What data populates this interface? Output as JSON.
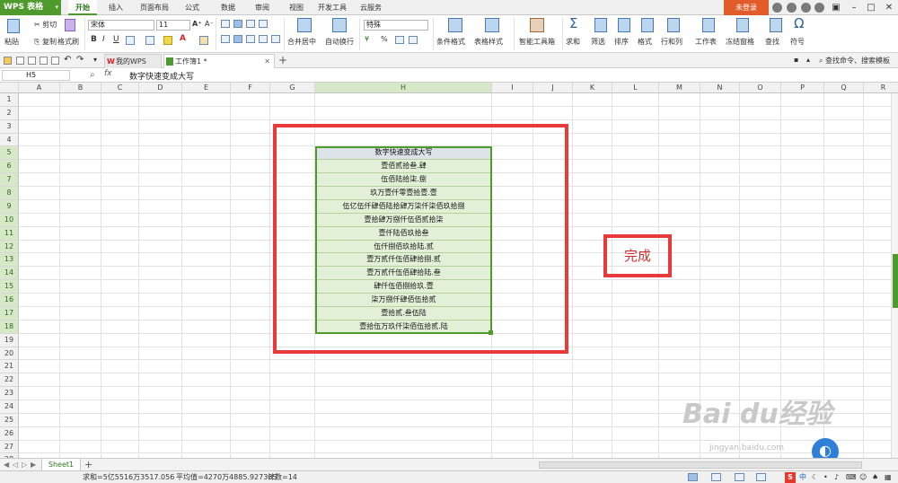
{
  "app": {
    "logo": "WPS 表格"
  },
  "menu": [
    "开始",
    "插入",
    "页面布局",
    "公式",
    "数据",
    "审阅",
    "视图",
    "开发工具",
    "云服务"
  ],
  "login": "未登录",
  "ribbon": {
    "paste": "粘贴",
    "cut": "剪切",
    "copy": "复制",
    "format_painter": "格式刷",
    "font_name": "宋体",
    "font_size": "11",
    "bold": "B",
    "italic": "I",
    "underline": "U",
    "grow_font": "A⁺",
    "shrink_font": "A⁻",
    "merge_center": "合并居中",
    "wrap_text": "自动换行",
    "number_format": "特殊",
    "percent": "%",
    "cond_format": "条件格式",
    "table_style": "表格样式",
    "smart_toolbox": "智能工具箱",
    "sum": "求和",
    "filter": "筛选",
    "sort": "排序",
    "format": "格式",
    "row_col": "行和列",
    "worksheet": "工作表",
    "freeze": "冻结窗格",
    "find": "查找",
    "symbol": "符号"
  },
  "tabs": {
    "wps_home": "我的WPS",
    "doc_tab": "工作簿1 *",
    "search": "查找命令、搜索模板"
  },
  "formula_bar": {
    "name_box": "H5",
    "fx": "fx",
    "formula": "数字快速变成大写"
  },
  "columns": [
    "A",
    "B",
    "C",
    "D",
    "E",
    "F",
    "G",
    "H",
    "I",
    "J",
    "K",
    "L",
    "M",
    "N",
    "O",
    "P",
    "Q",
    "R"
  ],
  "rows": [
    "1",
    "2",
    "3",
    "4",
    "5",
    "6",
    "7",
    "8",
    "9",
    "10",
    "11",
    "12",
    "13",
    "14",
    "15",
    "16",
    "17",
    "18",
    "19",
    "20",
    "21",
    "22",
    "23",
    "24",
    "25",
    "26",
    "27",
    "28"
  ],
  "table": {
    "header": "数字快速变成大写",
    "values": [
      "壹佰贰拾叁.肆",
      "伍佰陆拾柒.捌",
      "玖万壹仟零壹拾壹.壹",
      "伍亿伍仟肆佰陆拾肆万柒仟柒佰玖拾捌",
      "壹拾肆万捌仟伍佰贰拾柒",
      "壹仟陆佰玖拾叁",
      "伍仟捌佰玖拾陆.贰",
      "壹万贰仟伍佰肆拾捌.贰",
      "壹万贰仟伍佰肆拾陆.叁",
      "肆仟伍佰捌拾玖.壹",
      "柒万捌仟肆佰伍拾贰",
      "壹拾贰.叁伍陆",
      "壹拾伍万玖仟柒佰伍拾贰.陆"
    ]
  },
  "annotation": "完成",
  "sheet": {
    "name": "Sheet1",
    "add": "+"
  },
  "status": {
    "sum": "求和=5亿5516万3517.056",
    "avg": "平均值=4270万4885.927385",
    "count": "计数=14"
  },
  "watermark": {
    "main": "Bai du经验",
    "sub": "jingyan.baidu.com"
  },
  "colors": {
    "accent": "#4e9a2d",
    "red": "#e83a3a",
    "login": "#e25c2a"
  }
}
